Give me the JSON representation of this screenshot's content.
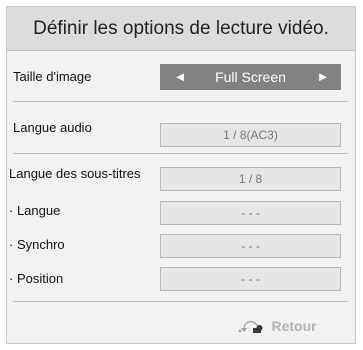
{
  "header": {
    "title": "Définir les options de lecture vidéo."
  },
  "rows": {
    "image_size": {
      "label": "Taille d'image",
      "value": "Full Screen",
      "left_arrow": "◄",
      "right_arrow": "►"
    },
    "audio_language": {
      "label": "Langue audio",
      "value": "1 / 8(AC3)"
    },
    "subtitle_language": {
      "label": "Langue des sous-titres",
      "value": "1 / 8"
    },
    "language": {
      "label": "· Langue",
      "value": "- - -"
    },
    "sync": {
      "label": "· Synchro",
      "value": "- - -"
    },
    "position": {
      "label": "· Position",
      "value": "- - -"
    }
  },
  "footer": {
    "back_label": "Retour",
    "back_icon": "return-arrow-icon"
  },
  "colors": {
    "selected_background": "#828282",
    "panel_background": "#f2f2f2",
    "header_background": "#dcdcdc",
    "back_text": "#b3b3b3"
  }
}
